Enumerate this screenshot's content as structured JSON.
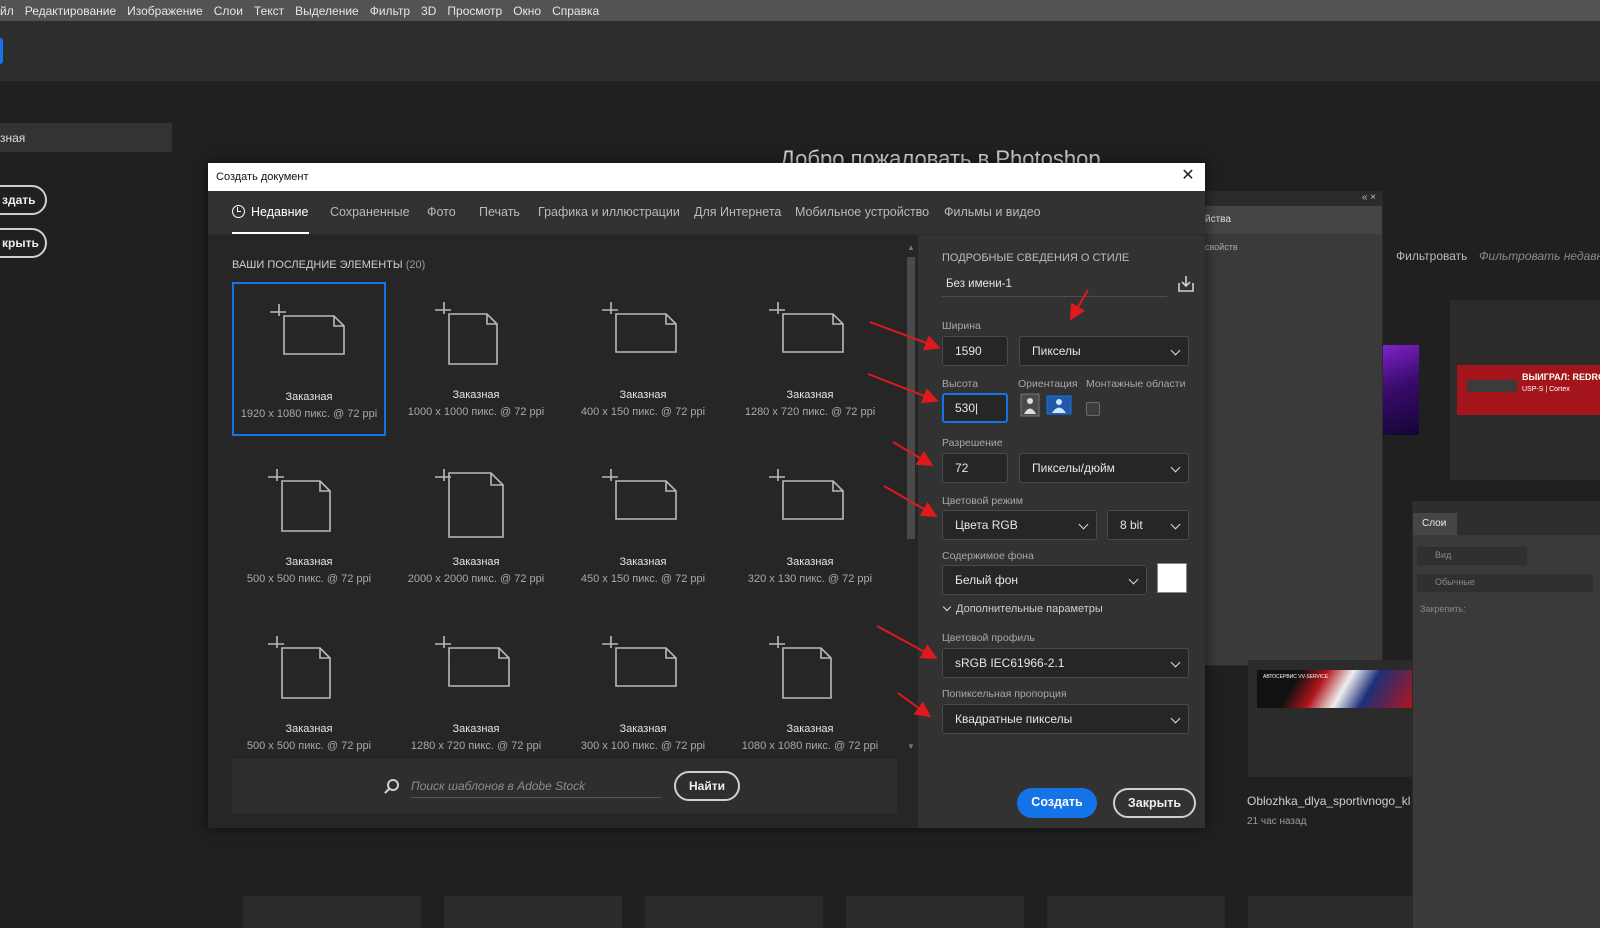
{
  "menu": [
    "йл",
    "Редактирование",
    "Изображение",
    "Слои",
    "Текст",
    "Выделение",
    "Фильтр",
    "3D",
    "Просмотр",
    "Окно",
    "Справка"
  ],
  "home": {
    "recent_label": "зная",
    "create_btn": "здать",
    "open_btn": "крыть",
    "welcome": "Добро пожаловать в Photoshop"
  },
  "background": {
    "props_tab": "йства",
    "props_sub": "свойств",
    "props_top": "«  ×",
    "filter_label": "Фильтровать",
    "filter_placeholder": "Фильтровать недавние",
    "red_thumb_line1": "ВЫИГРАЛ: REDROSE",
    "red_thumb_line2": "USP-S | Cortex",
    "banner_text": "АВТОСЕРВИС VV-SERVICE",
    "doc_name": "Oblozhka_dlya_sportivnogo_kl",
    "doc_time": "21 час назад",
    "layers_tab": "Слои",
    "layers_search": "Вид",
    "layers_blend": "Обычные",
    "layers_lock": "Закрепить:"
  },
  "dialog": {
    "title": "Создать документ",
    "tabs": [
      "Недавние",
      "Сохраненные",
      "Фото",
      "Печать",
      "Графика и иллюстрации",
      "Для Интернета",
      "Мобильное устройство",
      "Фильмы и видео"
    ],
    "recent_heading": "ВАШИ ПОСЛЕДНИЕ ЭЛЕМЕНТЫ",
    "recent_count": "(20)",
    "presets": [
      {
        "name": "Заказная",
        "size": "1920 x 1080 пикс. @ 72 ppi",
        "shape": "wide"
      },
      {
        "name": "Заказная",
        "size": "1000 x 1000 пикс. @ 72 ppi",
        "shape": "square"
      },
      {
        "name": "Заказная",
        "size": "400 x 150 пикс. @ 72 ppi",
        "shape": "wide"
      },
      {
        "name": "Заказная",
        "size": "1280 x 720 пикс. @ 72 ppi",
        "shape": "wide"
      },
      {
        "name": "Заказная",
        "size": "500 x 500 пикс. @ 72 ppi",
        "shape": "square"
      },
      {
        "name": "Заказная",
        "size": "2000 x 2000 пикс. @ 72 ppi",
        "shape": "squarebig"
      },
      {
        "name": "Заказная",
        "size": "450 x 150 пикс. @ 72 ppi",
        "shape": "wide"
      },
      {
        "name": "Заказная",
        "size": "320 x 130 пикс. @ 72 ppi",
        "shape": "wide"
      },
      {
        "name": "Заказная",
        "size": "500 x 500 пикс. @ 72 ppi",
        "shape": "square"
      },
      {
        "name": "Заказная",
        "size": "1280 x 720 пикс. @ 72 ppi",
        "shape": "wide"
      },
      {
        "name": "Заказная",
        "size": "300 x 100 пикс. @ 72 ppi",
        "shape": "wide"
      },
      {
        "name": "Заказная",
        "size": "1080 x 1080 пикс. @ 72 ppi",
        "shape": "square"
      }
    ],
    "search_placeholder": "Поиск шаблонов в Adobe Stock",
    "find_btn": "Найти",
    "details": {
      "heading": "ПОДРОБНЫЕ СВЕДЕНИЯ О СТИЛЕ",
      "doc_name": "Без имени-1",
      "width_label": "Ширина",
      "width_value": "1590",
      "width_unit": "Пикселы",
      "height_label": "Высота",
      "height_value": "530",
      "orientation_label": "Ориентация",
      "artboards_label": "Монтажные области",
      "resolution_label": "Разрешение",
      "resolution_value": "72",
      "resolution_unit": "Пикселы/дюйм",
      "color_mode_label": "Цветовой режим",
      "color_mode": "Цвета RGB",
      "bit_depth": "8 bit",
      "bg_label": "Содержимое фона",
      "bg_value": "Белый фон",
      "bg_color": "#ffffff",
      "advanced": "Дополнительные параметры",
      "profile_label": "Цветовой профиль",
      "profile_value": "sRGB IEC61966-2.1",
      "pixel_aspect_label": "Попиксельная пропорция",
      "pixel_aspect_value": "Квадратные пикселы",
      "create_btn": "Создать",
      "close_btn": "Закрыть"
    }
  },
  "colors": {
    "accent": "#1473e6",
    "arrow": "#e0191e"
  }
}
